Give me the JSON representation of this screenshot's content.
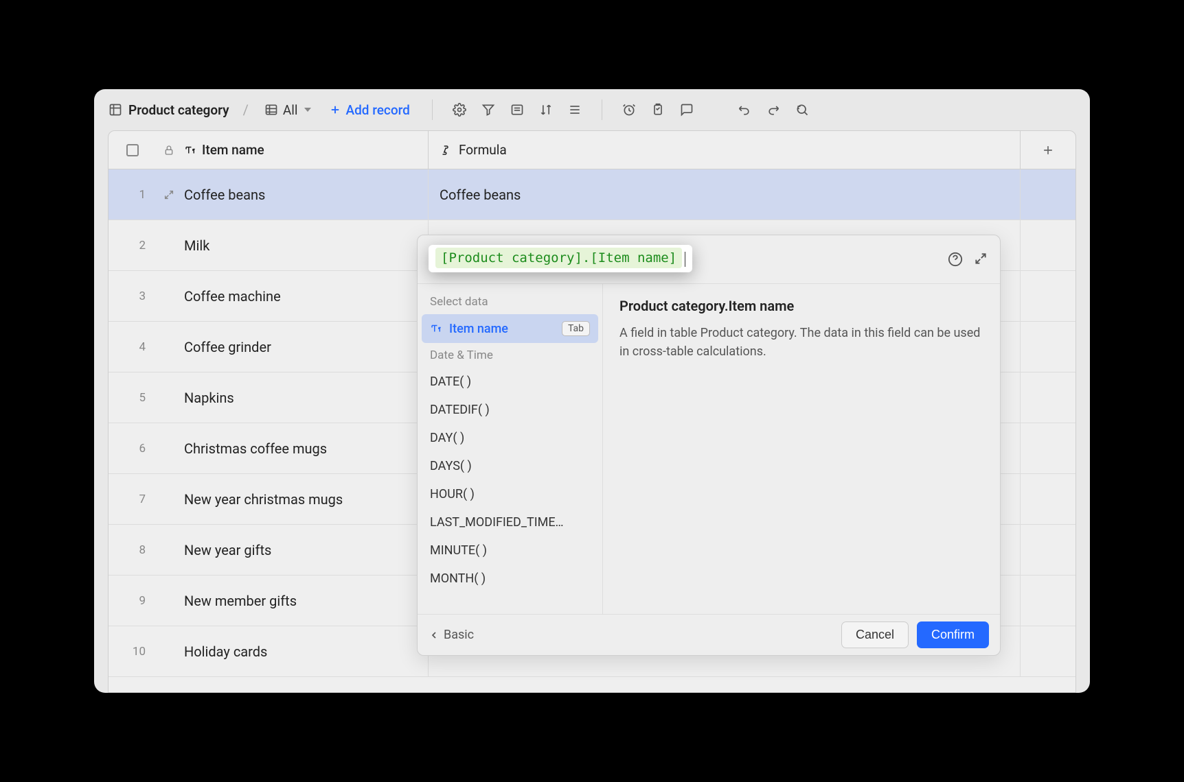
{
  "toolbar": {
    "table_title": "Product category",
    "view_label": "All",
    "add_record_label": "Add record"
  },
  "columns": {
    "item_name_header": "Item name",
    "formula_header": "Formula"
  },
  "rows": [
    {
      "idx": "1",
      "name": "Coffee beans",
      "formula": "Coffee beans",
      "selected": true,
      "show_expand": true
    },
    {
      "idx": "2",
      "name": "Milk",
      "formula": ""
    },
    {
      "idx": "3",
      "name": "Coffee machine",
      "formula": ""
    },
    {
      "idx": "4",
      "name": "Coffee grinder",
      "formula": ""
    },
    {
      "idx": "5",
      "name": "Napkins",
      "formula": ""
    },
    {
      "idx": "6",
      "name": "Christmas coffee mugs",
      "formula": ""
    },
    {
      "idx": "7",
      "name": "New year christmas mugs",
      "formula": ""
    },
    {
      "idx": "8",
      "name": "New year gifts",
      "formula": ""
    },
    {
      "idx": "9",
      "name": "New member gifts",
      "formula": ""
    },
    {
      "idx": "10",
      "name": "Holiday cards",
      "formula": ""
    }
  ],
  "popover": {
    "formula_text": "[Product category].[Item name]",
    "groups": [
      {
        "label": "Select data",
        "items": [
          {
            "label": "Item name",
            "selected": true,
            "hint": "Tab",
            "icon": "text-field-icon"
          }
        ]
      },
      {
        "label": "Date & Time",
        "items": [
          {
            "label": "DATE( )"
          },
          {
            "label": "DATEDIF( )"
          },
          {
            "label": "DAY( )"
          },
          {
            "label": "DAYS( )"
          },
          {
            "label": "HOUR( )"
          },
          {
            "label": "LAST_MODIFIED_TIME…"
          },
          {
            "label": "MINUTE( )"
          },
          {
            "label": "MONTH( )"
          }
        ]
      }
    ],
    "detail": {
      "title": "Product category.Item name",
      "description": "A field in table Product category. The data in this field can be used in cross-table calculations."
    },
    "footer": {
      "back_label": "Basic",
      "cancel_label": "Cancel",
      "confirm_label": "Confirm"
    }
  }
}
